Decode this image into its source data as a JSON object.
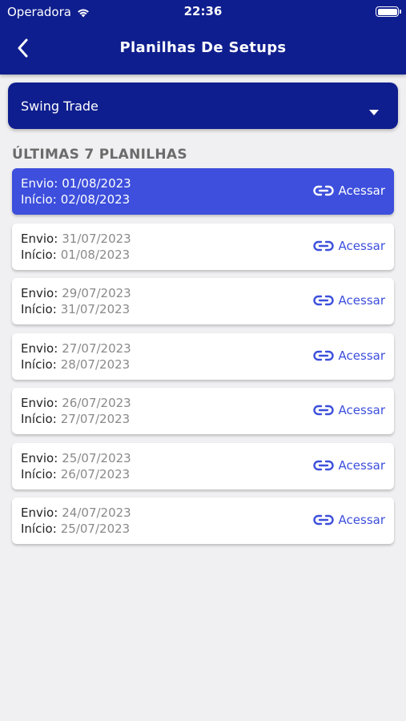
{
  "status_bar": {
    "carrier": "Operadora",
    "time": "22:36"
  },
  "nav": {
    "title": "Planilhas De Setups"
  },
  "dropdown": {
    "selected": "Swing Trade"
  },
  "section_title": "ÚLTIMAS 7 PLANILHAS",
  "labels": {
    "envio": "Envio:",
    "inicio": "Início:",
    "access": "Acessar"
  },
  "colors": {
    "header": "#0f1e8e",
    "accent": "#3d4fdc",
    "background": "#f0f0f2"
  },
  "items": [
    {
      "envio": "01/08/2023",
      "inicio": "02/08/2023",
      "selected": true
    },
    {
      "envio": "31/07/2023",
      "inicio": "01/08/2023",
      "selected": false
    },
    {
      "envio": "29/07/2023",
      "inicio": "31/07/2023",
      "selected": false
    },
    {
      "envio": "27/07/2023",
      "inicio": "28/07/2023",
      "selected": false
    },
    {
      "envio": "26/07/2023",
      "inicio": "27/07/2023",
      "selected": false
    },
    {
      "envio": "25/07/2023",
      "inicio": "26/07/2023",
      "selected": false
    },
    {
      "envio": "24/07/2023",
      "inicio": "25/07/2023",
      "selected": false
    }
  ]
}
